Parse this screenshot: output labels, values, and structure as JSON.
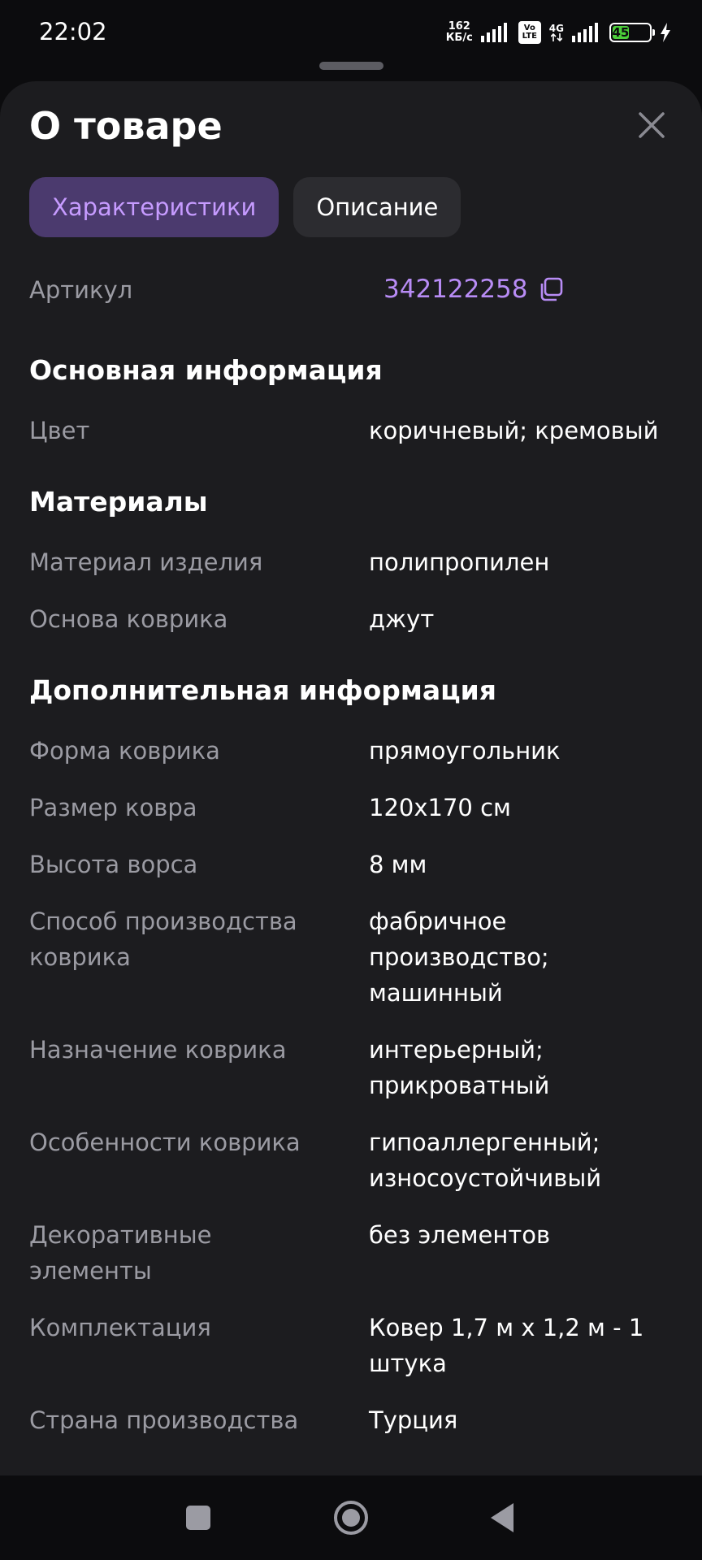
{
  "status": {
    "time": "22:02",
    "speed_value": "162",
    "speed_unit": "КБ/с",
    "volte_top": "Vo",
    "volte_bottom": "LTE",
    "network": "4G",
    "battery": "45",
    "battery_level_percent": 45
  },
  "sheet": {
    "title": "О товаре"
  },
  "tabs": [
    {
      "label": "Характеристики",
      "active": true
    },
    {
      "label": "Описание",
      "active": false
    }
  ],
  "article": {
    "label": "Артикул",
    "value": "342122258"
  },
  "sections": {
    "main": {
      "title": "Основная информация",
      "rows": [
        {
          "label": "Цвет",
          "value": "коричневый; кремовый"
        }
      ]
    },
    "materials": {
      "title": "Материалы",
      "rows": [
        {
          "label": "Материал изделия",
          "value": "полипропилен"
        },
        {
          "label": "Основа коврика",
          "value": "джут"
        }
      ]
    },
    "additional": {
      "title": "Дополнительная информация",
      "rows": [
        {
          "label": "Форма коврика",
          "value": "прямоугольник"
        },
        {
          "label": "Размер ковра",
          "value": "120х170 см"
        },
        {
          "label": "Высота ворса",
          "value": "8 мм"
        },
        {
          "label": "Способ производства коврика",
          "value": "фабричное производство; машинный"
        },
        {
          "label": "Назначение коврика",
          "value": "интерьерный; прикроватный"
        },
        {
          "label": "Особенности коврика",
          "value": "гипоаллергенный; износоустойчивый"
        },
        {
          "label": "Декоративные элементы",
          "value": "без элементов"
        },
        {
          "label": "Комплектация",
          "value": "Ковер 1,7 м х 1,2 м - 1 штука"
        },
        {
          "label": "Страна производства",
          "value": "Турция"
        }
      ]
    }
  },
  "icons": {
    "close": "close-icon",
    "copy": "copy-icon",
    "nav_recents": "square-icon",
    "nav_home": "circle-icon",
    "nav_back": "triangle-back-icon"
  },
  "colors": {
    "accent": "#b88cf5",
    "active_tab_bg": "#4b3a6e",
    "sheet_bg": "#1c1c1f",
    "battery_fill": "#4ccf3a"
  }
}
